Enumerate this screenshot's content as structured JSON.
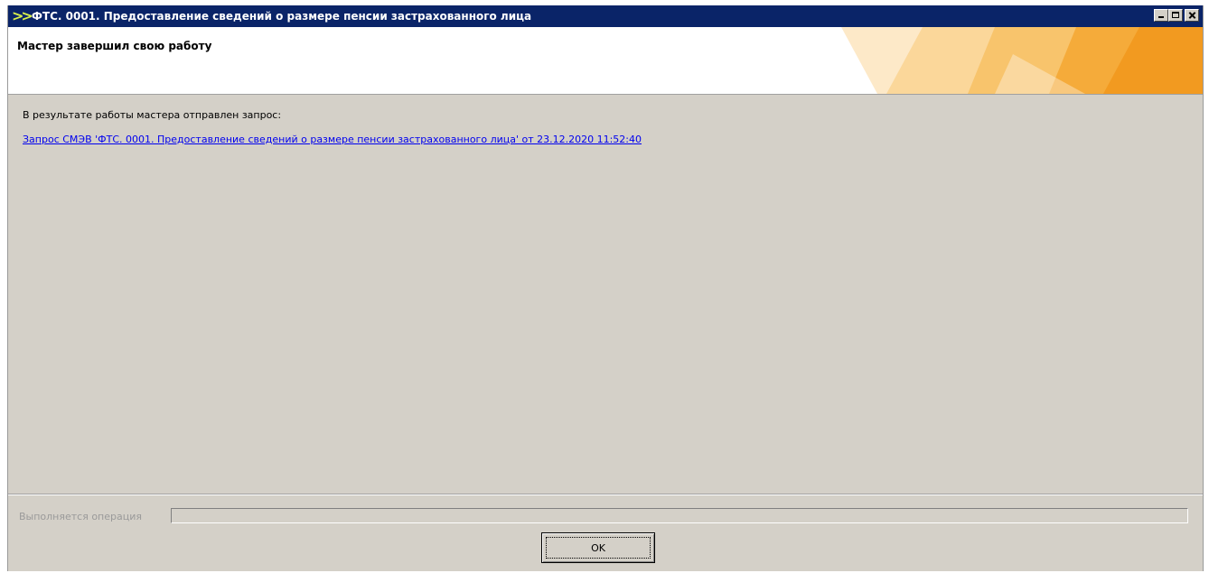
{
  "window": {
    "title": "ФТС. 0001. Предоставление сведений о размере пенсии застрахованного лица",
    "controls": [
      "minimize-icon",
      "maximize-icon",
      "close-icon"
    ]
  },
  "header": {
    "title": "Мастер завершил свою работу"
  },
  "main": {
    "intro": "В результате работы мастера отправлен запрос:",
    "request_link": "Запрос СМЭВ 'ФТС. 0001. Предоставление сведений о размере пенсии застрахованного лица' от 23.12.2020 11:52:40"
  },
  "footer": {
    "progress_label": "Выполняется операция",
    "progress_value": 0,
    "ok_label": "OK"
  },
  "colors": {
    "titlebar": "#0a2468",
    "window_bg": "#d4d0c8",
    "link": "#0000ee",
    "accent_orange": "#f5a623"
  }
}
